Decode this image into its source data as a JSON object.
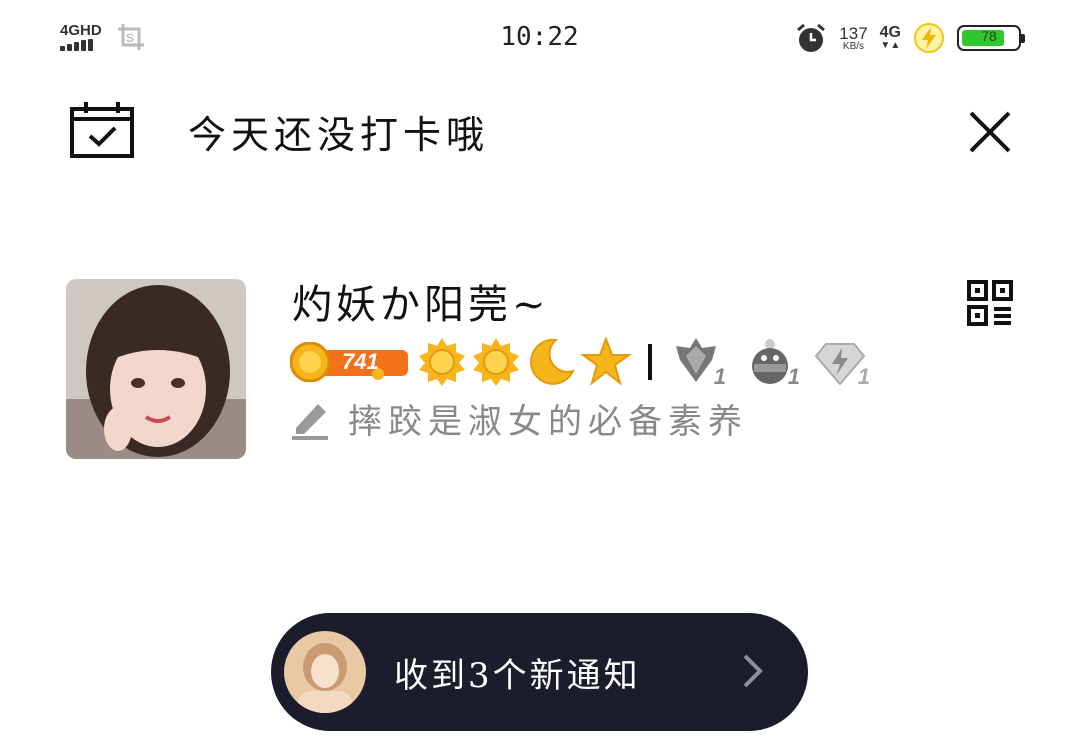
{
  "status_bar": {
    "network_left": "4GHD",
    "time": "10:22",
    "net_speed_value": "137",
    "net_speed_unit": "KB/s",
    "network_right": "4G",
    "battery_level": 78,
    "battery_label": "78"
  },
  "header": {
    "title": "今天还没打卡哦"
  },
  "profile": {
    "nickname": "灼妖か阳莞~",
    "level": "741",
    "signature": "摔跤是淑女的必备素养",
    "badge_counts": [
      "1",
      "1",
      "1"
    ]
  },
  "notice": {
    "text": "收到3个新通知"
  },
  "colors": {
    "notice_bg": "#1b1d2c",
    "level_orange": "#f4711c",
    "gold": "#f6b61b",
    "battery_green": "#2ec72e"
  }
}
